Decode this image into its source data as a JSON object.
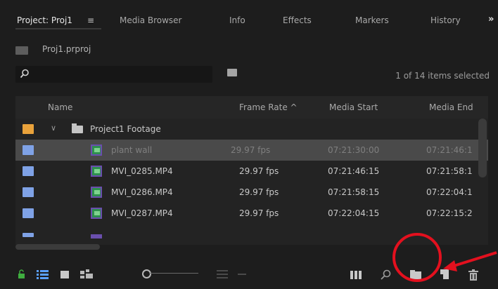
{
  "tabs": [
    {
      "label": "Project: Proj1",
      "active": true
    },
    {
      "label": "≡",
      "active": false
    },
    {
      "label": "Media Browser",
      "active": false
    },
    {
      "label": "Info",
      "active": false
    },
    {
      "label": "Effects",
      "active": false
    },
    {
      "label": "Markers",
      "active": false
    },
    {
      "label": "History",
      "active": false
    }
  ],
  "more_label": "»",
  "project": {
    "name": "Proj1.prproj"
  },
  "search": {
    "value": "",
    "placeholder": ""
  },
  "selection_info": "1 of 14 items selected",
  "columns": {
    "name": "Name",
    "frame_rate": "Frame Rate ^",
    "media_start": "Media Start",
    "media_end": "Media End"
  },
  "folder_row": {
    "name": "Project1 Footage",
    "label_color": "#e9a23b"
  },
  "rows": [
    {
      "name": "plant wall",
      "frame_rate": "29.97 fps",
      "media_start": "07:21:30:00",
      "media_end": "07:21:46:1",
      "selected": true
    },
    {
      "name": "MVI_0285.MP4",
      "frame_rate": "29.97 fps",
      "media_start": "07:21:46:15",
      "media_end": "07:21:58:1",
      "selected": false
    },
    {
      "name": "MVI_0286.MP4",
      "frame_rate": "29.97 fps",
      "media_start": "07:21:58:15",
      "media_end": "07:22:04:1",
      "selected": false
    },
    {
      "name": "MVI_0287.MP4",
      "frame_rate": "29.97 fps",
      "media_start": "07:22:04:15",
      "media_end": "07:22:15:2",
      "selected": false
    }
  ],
  "clip_label_color": "#7fa2e6",
  "toolbar_icons": [
    "lock-icon",
    "list-view-icon",
    "icon-view-icon",
    "freeform-view-icon",
    "zoom-slider",
    "sort-icon",
    "automate-to-sequence-icon",
    "find-icon",
    "new-bin-icon",
    "new-item-icon",
    "trash-icon"
  ],
  "annotation_color": "#e3101e"
}
